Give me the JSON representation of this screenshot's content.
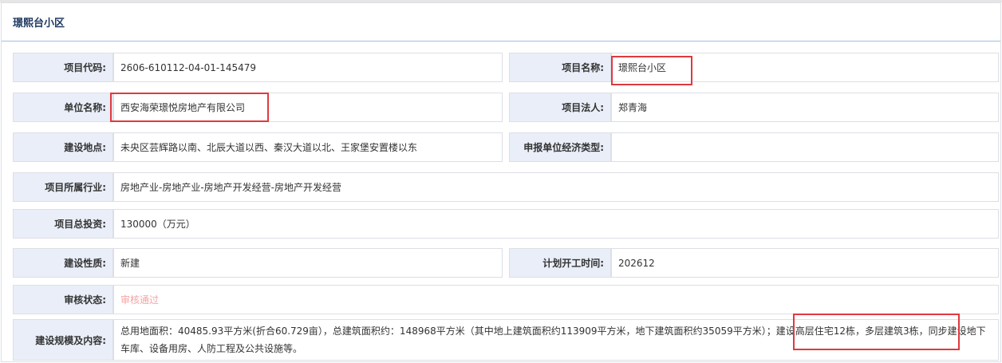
{
  "panel": {
    "title": "璟熙台小区"
  },
  "fields": {
    "project_code": {
      "label": "项目代码:",
      "value": "2606-610112-04-01-145479"
    },
    "project_name": {
      "label": "项目名称:",
      "value": "璟熙台小区"
    },
    "unit_name": {
      "label": "单位名称:",
      "value": "西安海荣璟悦房地产有限公司"
    },
    "legal_person": {
      "label": "项目法人:",
      "value": "郑青海"
    },
    "location": {
      "label": "建设地点:",
      "value": "未央区芸辉路以南、北辰大道以西、秦汉大道以北、王家堡安置楼以东"
    },
    "economic_type": {
      "label": "申报单位经济类型:",
      "value": ""
    },
    "industry": {
      "label": "项目所属行业:",
      "value": "房地产业-房地产业-房地产开发经营-房地产开发经营"
    },
    "total_investment": {
      "label": "项目总投资:",
      "value": "130000（万元）"
    },
    "construction_nature": {
      "label": "建设性质:",
      "value": "新建"
    },
    "planned_start": {
      "label": "计划开工时间:",
      "value": "202612"
    },
    "review_status": {
      "label": "审核状态:",
      "value": "审核通过"
    },
    "scale": {
      "label": "建设规模及内容:",
      "value": "总用地面积：40485.93平方米(折合60.729亩），总建筑面积约：148968平方米（其中地上建筑面积约113909平方米，地下建筑面积约35059平方米）；建设高层住宅12栋，多层建筑3栋，同步建设地下车库、设备用房、人防工程及公共设施等。"
    }
  },
  "colors": {
    "label_bg": "#e9eef8",
    "border": "#dcdfe6",
    "title": "#1f3a60",
    "highlight": "#e0393e",
    "status": "#f5a3a3"
  }
}
